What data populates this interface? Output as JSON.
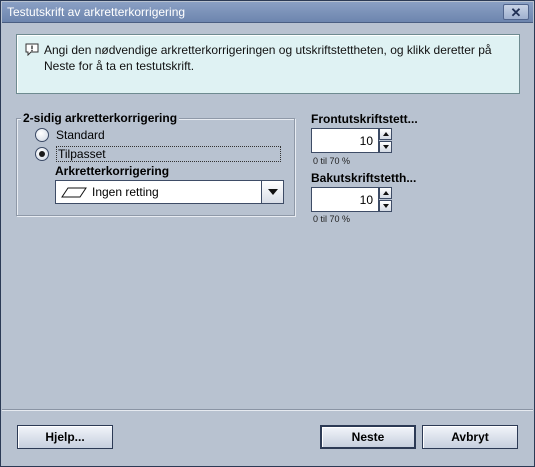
{
  "window": {
    "title": "Testutskrift av arkretterkorrigering",
    "close_symbol": "✕"
  },
  "info": {
    "icon": "info-speech-bubble-icon",
    "text": "Angi den nødvendige arkretterkorrigeringen og utskriftstettheten, og klikk deretter på Neste for å ta en testutskrift."
  },
  "correction_group": {
    "label": "2-sidig arkretterkorrigering",
    "options": [
      {
        "label": "Standard",
        "checked": false
      },
      {
        "label": "Tilpasset",
        "checked": true
      }
    ],
    "sub_label": "Arkretterkorrigering",
    "dropdown": {
      "icon": "parallelogram-icon",
      "value": "Ingen retting"
    }
  },
  "front_density": {
    "label": "Frontutskriftstett...",
    "value": "10",
    "range": "0 til 70 %"
  },
  "back_density": {
    "label": "Bakutskriftstetth...",
    "value": "10",
    "range": "0 til 70 %"
  },
  "buttons": {
    "help": "Hjelp...",
    "next": "Neste",
    "cancel": "Avbryt"
  }
}
